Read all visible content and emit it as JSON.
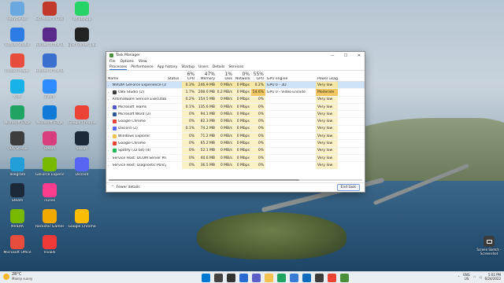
{
  "desktop_icons": [
    {
      "label": "Recycle Bin",
      "color": "#6aa9e0",
      "icon": "recycle-bin-icon"
    },
    {
      "label": "Sid Meier's Civilization VI",
      "color": "#c0392b",
      "icon": "game-icon"
    },
    {
      "label": "WhatsApp",
      "color": "#25d366",
      "icon": "whatsapp-icon"
    },
    {
      "label": "Roblox Studio",
      "color": "#2d7be5",
      "icon": "roblox-icon"
    },
    {
      "label": "Heroes of the Storm",
      "color": "#5a2a8a",
      "icon": "game-icon"
    },
    {
      "label": "Epic Games Launcher",
      "color": "#222222",
      "icon": "epic-icon"
    },
    {
      "label": "Roblox Player",
      "color": "#e74c3c",
      "icon": "roblox-icon"
    },
    {
      "label": "Heroes of the Storm",
      "color": "#3a6fd0",
      "icon": "game-icon"
    },
    {
      "label": "Kodi",
      "color": "#17b2e8",
      "icon": "kodi-icon"
    },
    {
      "label": "Zoom",
      "color": "#2d8cff",
      "icon": "zoom-icon"
    },
    {
      "label": "Microsoft Edge",
      "color": "#1fa463",
      "icon": "edge-icon"
    },
    {
      "label": "Microsoft Edge",
      "color": "#0f7bd6",
      "icon": "edge-icon"
    },
    {
      "label": "Google Chrome",
      "color": "#ea4335",
      "icon": "chrome-icon"
    },
    {
      "label": "OBS Studio",
      "color": "#3c3c3c",
      "icon": "obs-icon"
    },
    {
      "label": "Steam",
      "color": "#d63f7a",
      "icon": "app-icon"
    },
    {
      "label": "Steam",
      "color": "#1b2838",
      "icon": "steam-icon"
    },
    {
      "label": "Telegram",
      "color": "#229ed9",
      "icon": "telegram-icon"
    },
    {
      "label": "GeForce Experience",
      "color": "#76b900",
      "icon": "nvidia-icon"
    },
    {
      "label": "Discord",
      "color": "#5865f2",
      "icon": "discord-icon"
    },
    {
      "label": "Steam",
      "color": "#1b2838",
      "icon": "steam-icon"
    },
    {
      "label": "iTunes",
      "color": "#fc3c8d",
      "icon": "itunes-icon"
    },
    {
      "label": "NVIDIA",
      "color": "#76b900",
      "icon": "nvidia-icon"
    },
    {
      "label": "Rockstar Games Launcher",
      "color": "#f2a900",
      "icon": "rockstar-icon"
    },
    {
      "label": "Google Chrome",
      "color": "#fbbc05",
      "icon": "chrome-icon"
    },
    {
      "label": "Microsoft Office",
      "color": "#e74c3c",
      "icon": "office-icon"
    },
    {
      "label": "Vivaldi",
      "color": "#ef3939",
      "icon": "vivaldi-icon"
    }
  ],
  "taskmanager": {
    "title": "Task Manager",
    "menu": [
      "File",
      "Options",
      "View"
    ],
    "tabs": [
      "Processes",
      "Performance",
      "App history",
      "Startup",
      "Users",
      "Details",
      "Services"
    ],
    "active_tab": "Processes",
    "usage": {
      "cpu": "6%",
      "memory": "47%",
      "disk": "1%",
      "network": "0%",
      "gpu": "55%"
    },
    "columns": {
      "name": "Name",
      "status": "Status",
      "cpu": "CPU",
      "memory": "Memory",
      "disk": "Disk",
      "network": "Network",
      "gpu": "GPU",
      "gpu_engine": "GPU engine",
      "power": "Power usage"
    },
    "rows": [
      {
        "name": "NVIDIA GeForce Experience (3)",
        "cpu": "0.3%",
        "mem": "246.9 MB",
        "disk": "0 MB/s",
        "net": "0 Mbps",
        "gpu": "0.2%",
        "engine": "GPU 0 - 3D",
        "power": "Very low",
        "color": "#76b900",
        "expand": true,
        "selected": true
      },
      {
        "name": "OBS Studio (2)",
        "cpu": "1.7%",
        "mem": "208.0 MB",
        "disk": "0.2 MB/s",
        "net": "0 Mbps",
        "gpu": "54.6%",
        "engine": "GPU 0 - Video Encode",
        "power": "Moderate",
        "color": "#3c3c3c",
        "expand": true
      },
      {
        "name": "Antimalware Service Executable",
        "cpu": "0.2%",
        "mem": "154.5 MB",
        "disk": "0 MB/s",
        "net": "0 Mbps",
        "gpu": "0%",
        "engine": "",
        "power": "Very low",
        "color": "#2a6bd1",
        "expand": true
      },
      {
        "name": "Microsoft Teams",
        "cpu": "0.1%",
        "mem": "135.6 MB",
        "disk": "0 MB/s",
        "net": "0 Mbps",
        "gpu": "0%",
        "engine": "",
        "power": "Very low",
        "color": "#5059c9",
        "expand": true
      },
      {
        "name": "Microsoft Word (2)",
        "cpu": "0%",
        "mem": "94.1 MB",
        "disk": "0 MB/s",
        "net": "0 Mbps",
        "gpu": "0%",
        "engine": "",
        "power": "Very low",
        "color": "#2b579a",
        "expand": true
      },
      {
        "name": "Google Chrome",
        "cpu": "0%",
        "mem": "82.3 MB",
        "disk": "0 MB/s",
        "net": "0 Mbps",
        "gpu": "0%",
        "engine": "",
        "power": "Very low",
        "color": "#ea4335",
        "expand": false
      },
      {
        "name": "Discord (2)",
        "cpu": "0.1%",
        "mem": "74.2 MB",
        "disk": "0 MB/s",
        "net": "0 Mbps",
        "gpu": "0%",
        "engine": "",
        "power": "Very low",
        "color": "#5865f2",
        "expand": true
      },
      {
        "name": "Windows Explorer",
        "cpu": "0%",
        "mem": "71.2 MB",
        "disk": "0 MB/s",
        "net": "0 Mbps",
        "gpu": "0%",
        "engine": "",
        "power": "Very low",
        "color": "#f2c14e",
        "expand": true
      },
      {
        "name": "Google Chrome",
        "cpu": "0%",
        "mem": "65.2 MB",
        "disk": "0 MB/s",
        "net": "0 Mbps",
        "gpu": "0%",
        "engine": "",
        "power": "Very low",
        "color": "#ea4335",
        "expand": false
      },
      {
        "name": "Spotify (32 bit) (4)",
        "cpu": "0%",
        "mem": "52.1 MB",
        "disk": "0 MB/s",
        "net": "0 Mbps",
        "gpu": "0%",
        "engine": "",
        "power": "Very low",
        "color": "#1db954",
        "expand": true
      },
      {
        "name": "Service Host: DCOM Server Proc...",
        "cpu": "0%",
        "mem": "40.6 MB",
        "disk": "0 MB/s",
        "net": "0 Mbps",
        "gpu": "0%",
        "engine": "",
        "power": "Very low",
        "color": "#8fa8c8",
        "expand": true
      },
      {
        "name": "Service Host: Diagnostic Policy ...",
        "cpu": "0%",
        "mem": "36.5 MB",
        "disk": "0 MB/s",
        "net": "0 Mbps",
        "gpu": "0%",
        "engine": "",
        "power": "Very low",
        "color": "#8fa8c8",
        "expand": true
      }
    ],
    "fewer_details": "Fewer details",
    "end_task": "End task"
  },
  "taskbar": {
    "temp": "28°C",
    "condition": "Mainly sunny",
    "time": "5:01 PM",
    "date": "6/24/2022",
    "lang_top": "ENG",
    "lang_bottom": "US",
    "apps": [
      {
        "icon": "windows-start-icon",
        "color": "#0078d4"
      },
      {
        "icon": "search-icon",
        "color": "#444444"
      },
      {
        "icon": "task-view-icon",
        "color": "#333333"
      },
      {
        "icon": "widgets-icon",
        "color": "#2a6bd1"
      },
      {
        "icon": "chat-icon",
        "color": "#5b5fc7"
      },
      {
        "icon": "file-explorer-icon",
        "color": "#f2c14e"
      },
      {
        "icon": "edge-icon",
        "color": "#1fa463"
      },
      {
        "icon": "store-icon",
        "color": "#3a7bd5"
      },
      {
        "icon": "mail-icon",
        "color": "#0f6cbd"
      },
      {
        "icon": "obs-icon",
        "color": "#3c3c3c"
      },
      {
        "icon": "chrome-icon",
        "color": "#ea4335"
      },
      {
        "icon": "task-manager-icon",
        "color": "#4a8f3c"
      }
    ]
  },
  "screen_capture_label": "Screen Sketch - Screenshot"
}
